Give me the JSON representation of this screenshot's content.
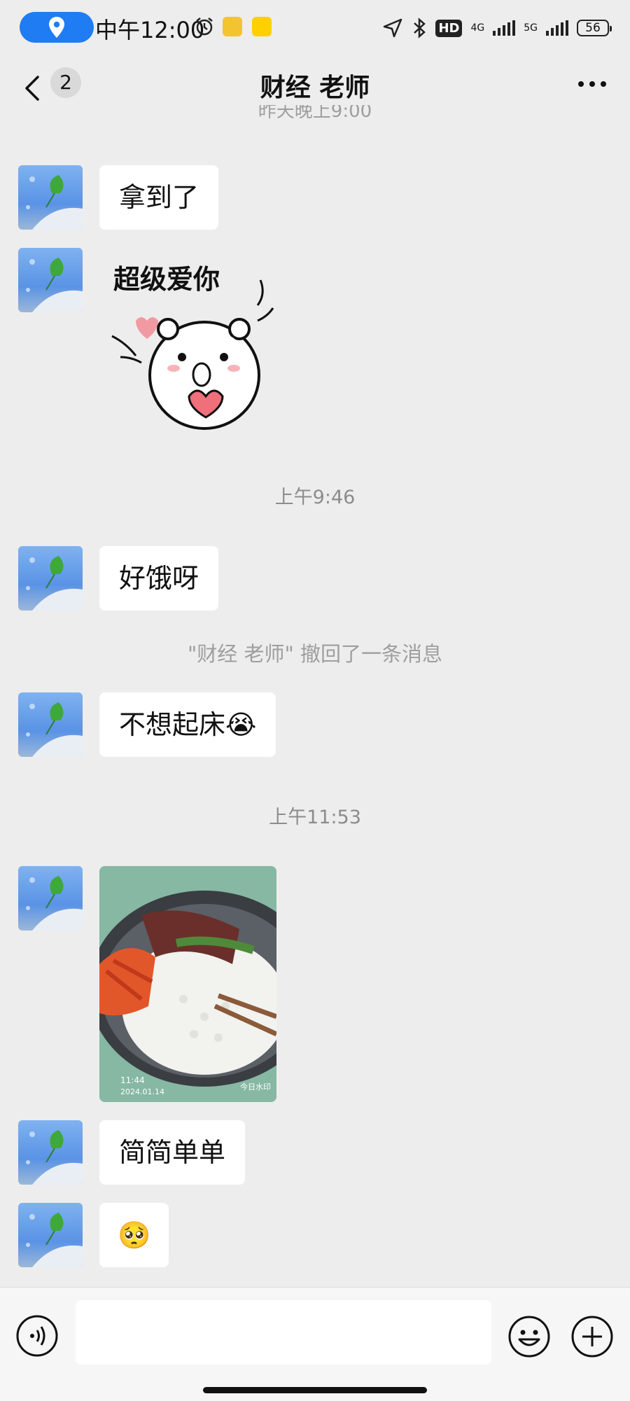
{
  "status_bar": {
    "time": "中午12:00",
    "hd_label": "HD",
    "net1": "4G",
    "net2": "5G",
    "battery": "56"
  },
  "header": {
    "back_badge": "2",
    "title": "财经 老师"
  },
  "messages": {
    "cut_timestamp": "昨天晚上9:00",
    "m1": "拿到了",
    "sticker_text": "超级爱你",
    "time1": "上午9:46",
    "m2": "好饿呀",
    "recall_notice": "\"财经 老师\" 撤回了一条消息",
    "m3": "不想起床",
    "m3_emoji": "😭",
    "time2": "上午11:53",
    "photo_stamp_time": "11:44",
    "photo_stamp_date": "2024.01.14",
    "photo_stamp_brand": "今日水印",
    "m4": "简简单单",
    "m5_emoji": "🥺"
  },
  "input_bar": {
    "placeholder": ""
  },
  "colors": {
    "background": "#ededed",
    "bubble": "#ffffff",
    "accent_location": "#1f7cf2"
  }
}
